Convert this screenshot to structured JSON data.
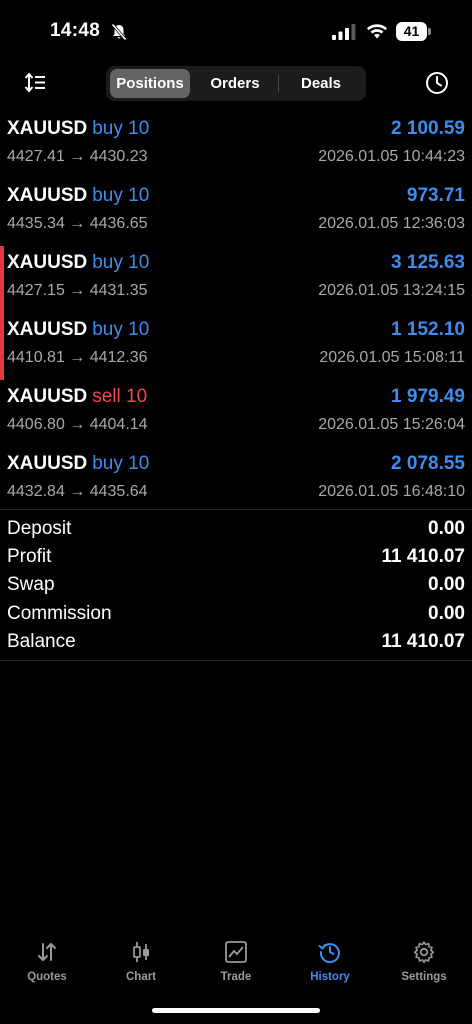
{
  "status_bar": {
    "time": "14:48",
    "battery": "41",
    "icons": [
      "bell-slash-icon",
      "cellular-signal-icon",
      "wifi-icon",
      "battery-icon"
    ]
  },
  "toolbar": {
    "sort_icon": "sort-icon",
    "tabs": [
      {
        "label": "Positions",
        "active": true
      },
      {
        "label": "Orders",
        "active": false
      },
      {
        "label": "Deals",
        "active": false
      }
    ],
    "clock_icon": "clock-icon"
  },
  "deals": [
    {
      "symbol": "XAUUSD",
      "side": "buy 10",
      "profit": "2 100.59",
      "prices": "4427.41 → 4430.23",
      "time": "2026.01.05 10:44:23",
      "marked": false
    },
    {
      "symbol": "XAUUSD",
      "side": "buy 10",
      "profit": "973.71",
      "prices": "4435.34 → 4436.65",
      "time": "2026.01.05 12:36:03",
      "marked": false
    },
    {
      "symbol": "XAUUSD",
      "side": "buy 10",
      "profit": "3 125.63",
      "prices": "4427.15 → 4431.35",
      "time": "2026.01.05 13:24:15",
      "marked": true
    },
    {
      "symbol": "XAUUSD",
      "side": "buy 10",
      "profit": "1 152.10",
      "prices": "4410.81 → 4412.36",
      "time": "2026.01.05 15:08:11",
      "marked": true
    },
    {
      "symbol": "XAUUSD",
      "side": "sell 10",
      "profit": "1 979.49",
      "prices": "4406.80 → 4404.14",
      "time": "2026.01.05 15:26:04",
      "marked": false
    },
    {
      "symbol": "XAUUSD",
      "side": "buy 10",
      "profit": "2 078.55",
      "prices": "4432.84 → 4435.64",
      "time": "2026.01.05 16:48:10",
      "marked": false
    }
  ],
  "summary": [
    {
      "label": "Deposit",
      "value": "0.00"
    },
    {
      "label": "Profit",
      "value": "11 410.07"
    },
    {
      "label": "Swap",
      "value": "0.00"
    },
    {
      "label": "Commission",
      "value": "0.00"
    },
    {
      "label": "Balance",
      "value": "11 410.07"
    }
  ],
  "tabbar": [
    {
      "label": "Quotes",
      "icon": "quotes-arrows-icon",
      "active": false
    },
    {
      "label": "Chart",
      "icon": "candlestick-chart-icon",
      "active": false
    },
    {
      "label": "Trade",
      "icon": "trade-chart-icon",
      "active": false
    },
    {
      "label": "History",
      "icon": "history-clock-icon",
      "active": true
    },
    {
      "label": "Settings",
      "icon": "settings-gear-icon",
      "active": false
    }
  ],
  "colors": {
    "accent_blue": "#3b8ef0",
    "sell_red": "#f2474b",
    "marker_red": "#e0393e",
    "background": "#000000"
  }
}
